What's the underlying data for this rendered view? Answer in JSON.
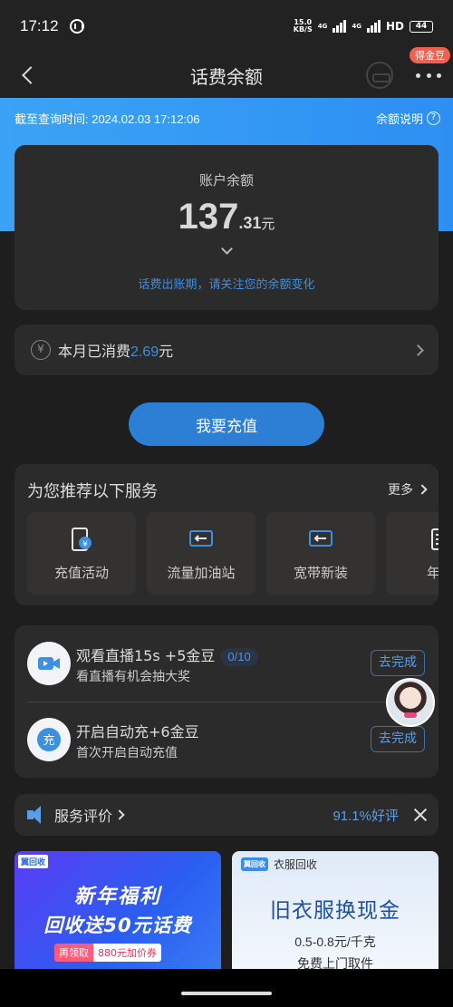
{
  "status_bar": {
    "time": "17:12",
    "speed_value": "15.0",
    "speed_unit": "KB/S",
    "network_4g_1": "4G",
    "network_4g_2": "4G",
    "hd": "HD",
    "battery": "44"
  },
  "nav": {
    "title": "话费余额",
    "badge": "得金豆"
  },
  "header": {
    "query_time": "截至查询时间: 2024.02.03 17:12:06",
    "balance_note": "余额说明"
  },
  "balance": {
    "label": "账户余额",
    "integer": "137",
    "decimal": ".31",
    "unit": "元",
    "tip": "话费出账期，请关注您的余额变化"
  },
  "consume": {
    "prefix": "本月已消费",
    "value": "2.69",
    "unit": "元"
  },
  "recharge_button": "我要充值",
  "recommend": {
    "title": "为您推荐以下服务",
    "more": "更多",
    "items": [
      {
        "label": "充值活动",
        "icon": "phone-yuan-icon"
      },
      {
        "label": "流量加油站",
        "icon": "data-arrow-icon"
      },
      {
        "label": "宽带新装",
        "icon": "broadband-icon"
      },
      {
        "label": "年度",
        "icon": "document-icon"
      }
    ]
  },
  "tasks": [
    {
      "title": "观看直播15s +5金豆",
      "progress": "0/10",
      "desc": "看直播有机会抽大奖",
      "button": "去完成",
      "icon": "video-camera-icon"
    },
    {
      "title": "开启自动充+6金豆",
      "desc": "首次开启自动充值",
      "button": "去完成",
      "icon": "chong-icon",
      "icon_text": "充"
    }
  ],
  "evaluation": {
    "label": "服务评价",
    "score": "91.1%好评"
  },
  "banners": {
    "left": {
      "logo": "翼回收",
      "line1": "新年福利",
      "line2": "回收送50元话费",
      "tag1": "再领取",
      "tag2": "880元加价券"
    },
    "right": {
      "logo_mark": "翼回收",
      "logo_text": "衣服回收",
      "title": "旧衣服换现金",
      "sub": "0.5-0.8元/千克",
      "sub2": "免费上门取件"
    }
  },
  "colors": {
    "accent_blue": "#3d8fe0",
    "header_blue": "#3ba3f5",
    "card_bg": "#2b2b2b",
    "page_bg": "#1e1e1e"
  }
}
